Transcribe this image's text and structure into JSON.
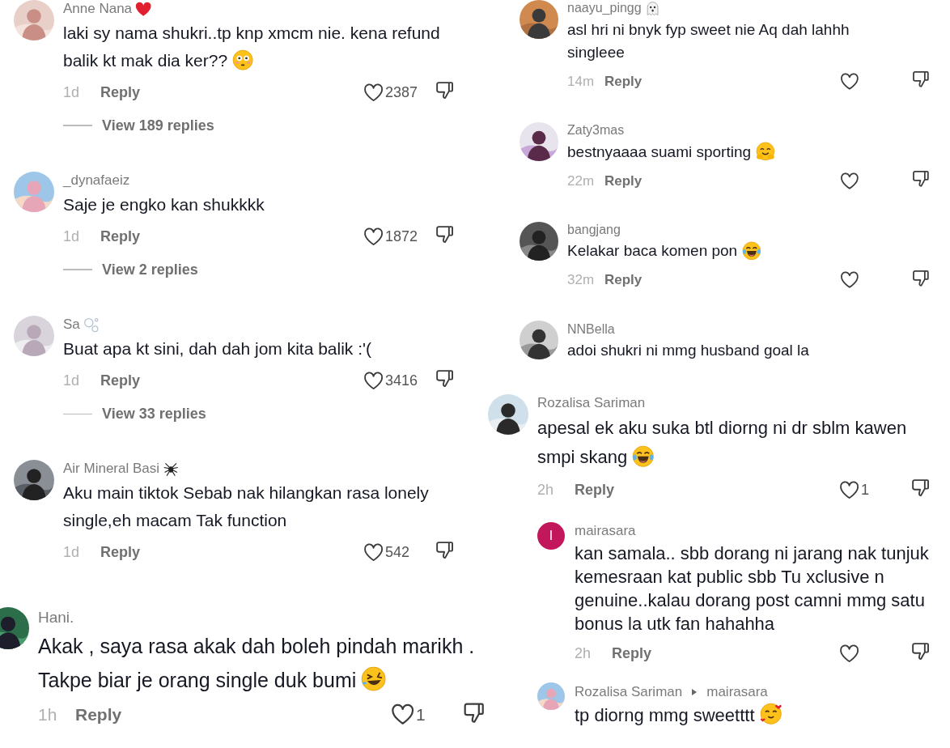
{
  "columns": [
    {
      "clips": [
        {
          "comments": [
            {
              "author": "Anne Nana",
              "name_icon": {
                "kind": "heart"
              },
              "text": "laki sy nama shukri..tp knp xmcm nie. kena refund balik kt mak dia ker??",
              "text_icon": {
                "kind": "flushed"
              },
              "time": "1d",
              "reply": "Reply",
              "likes": "2387",
              "view_replies": "View 189 replies"
            },
            {
              "author": "_dynafaeiz",
              "text": "Saje je engko kan shukkkk",
              "time": "1d",
              "reply": "Reply",
              "likes": "1872",
              "view_replies": "View 2 replies"
            },
            {
              "author": "Sa",
              "name_icon": {
                "kind": "bubbles"
              },
              "text": "Buat apa kt sini, dah dah jom kita balik :'(",
              "time": "1d",
              "reply": "Reply",
              "likes": "3416",
              "view_replies": "View 33 replies"
            },
            {
              "author": "Air Mineral Basi",
              "name_icon": {
                "kind": "spider"
              },
              "text": "Aku main tiktok Sebab nak hilangkan rasa lonely single,eh macam Tak function",
              "time": "1d",
              "reply": "Reply",
              "likes": "542"
            }
          ]
        },
        {
          "comments": [
            {
              "author": "Hani.",
              "text": "Akak , saya rasa akak dah boleh pindah marikh . Takpe biar je orang single duk bumi",
              "text_icon": {
                "kind": "rofl"
              },
              "time": "1h",
              "reply": "Reply",
              "likes": "1"
            }
          ]
        }
      ]
    },
    {
      "clips": [
        {
          "comments": [
            {
              "author": "naayu_pingg",
              "name_icon": {
                "kind": "ghost"
              },
              "text": "asl hri ni bnyk fyp sweet nie Aq dah lahhh singleee",
              "time": "14m",
              "reply": "Reply"
            },
            {
              "author": "Zaty3mas",
              "text": "bestnyaaaa suami sporting",
              "text_icon": {
                "kind": "hug"
              },
              "time": "22m",
              "reply": "Reply"
            },
            {
              "author": "bangjang",
              "text": "Kelakar baca komen pon",
              "text_icon": {
                "kind": "joy"
              },
              "time": "32m",
              "reply": "Reply"
            },
            {
              "author": "NNBella",
              "text": "adoi shukri ni mmg husband goal la"
            }
          ]
        },
        {
          "comments": [
            {
              "author": "Rozalisa Sariman",
              "text": "apesal ek aku suka btl diorng ni dr sblm kawen smpi skang",
              "text_icon": {
                "kind": "joy"
              },
              "time": "2h",
              "reply": "Reply",
              "likes": "1",
              "children": [
                {
                  "author": "mairasara",
                  "avatar": {
                    "kind": "initial",
                    "initial": "I"
                  },
                  "text": "kan samala.. sbb dorang ni jarang nak tunjuk kemesraan kat public sbb Tu xclusive n genuine..kalau dorang post camni mmg satu bonus la utk fan hahahha",
                  "time": "2h",
                  "reply": "Reply"
                },
                {
                  "author": "Rozalisa Sariman",
                  "reply_to": "mairasara",
                  "text": "tp diorng mmg sweetttt",
                  "text_icon": {
                    "kind": "hearts"
                  }
                }
              ]
            }
          ]
        }
      ]
    }
  ]
}
